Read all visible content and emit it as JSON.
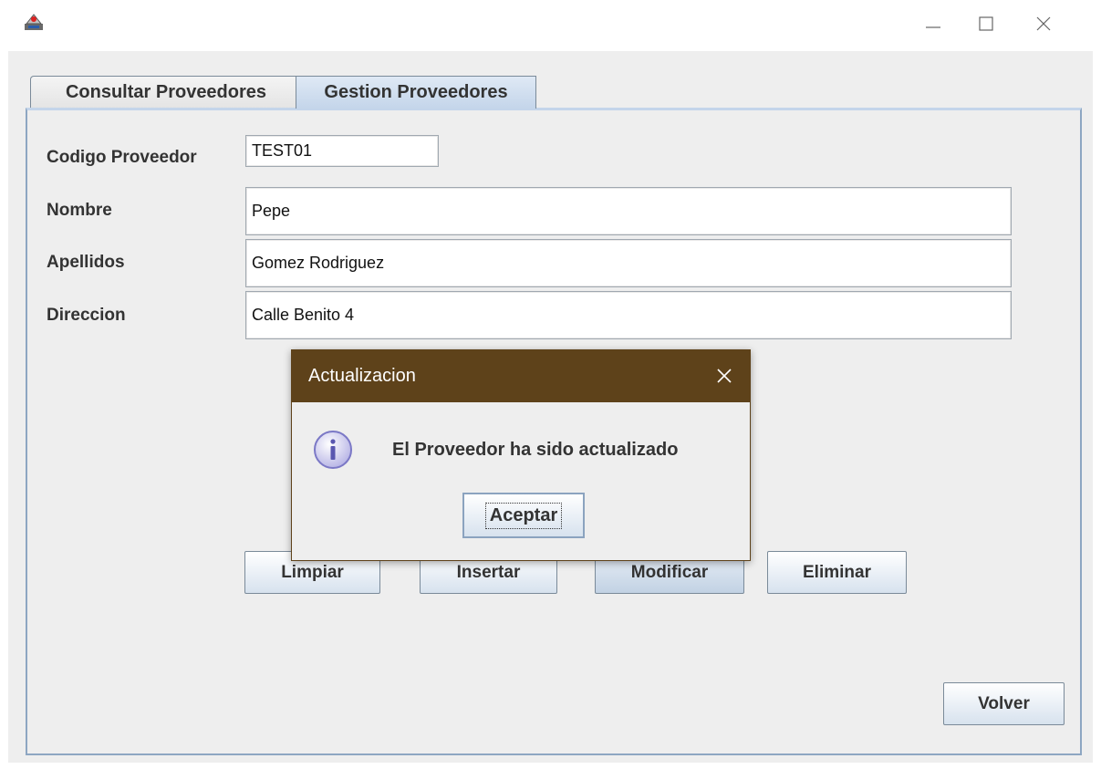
{
  "window": {
    "controls": [
      "minimize-icon",
      "maximize-icon",
      "close-icon"
    ]
  },
  "tabs": [
    {
      "label": "Consultar Proveedores",
      "selected": false
    },
    {
      "label": "Gestion Proveedores",
      "selected": true
    }
  ],
  "form": {
    "codigo_label": "Codigo Proveedor",
    "codigo_value": "TEST01",
    "nombre_label": "Nombre",
    "nombre_value": "Pepe",
    "apellidos_label": "Apellidos",
    "apellidos_value": "Gomez Rodriguez",
    "direccion_label": "Direccion",
    "direccion_value": "Calle Benito 4"
  },
  "actions": {
    "limpiar": "Limpiar",
    "insertar": "Insertar",
    "modificar": "Modificar",
    "eliminar": "Eliminar",
    "volver": "Volver"
  },
  "dialog": {
    "title": "Actualizacion",
    "message": "El Proveedor ha sido actualizado",
    "ok_label": "Aceptar",
    "icon": "info-icon",
    "title_bar_color": "#5e421a"
  },
  "colors": {
    "tab_selected": "#c4d5ea",
    "panel_border": "#8da6c2"
  }
}
